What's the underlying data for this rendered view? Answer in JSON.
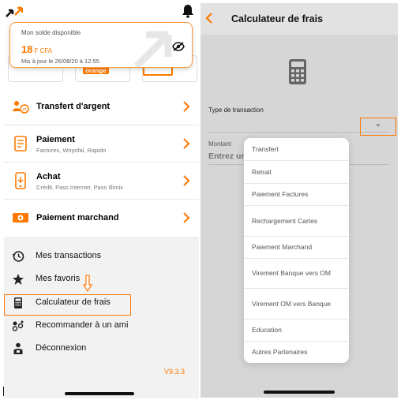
{
  "left": {
    "balance": {
      "label": "Mon solde disponible",
      "amount": "18",
      "currency": "F CFA",
      "updated": "Mis à jour le 26/08/20 à 12:55"
    },
    "orange_tag": "orange",
    "menu": [
      {
        "title": "Transfert d'argent",
        "subtitle": "",
        "icon": "transfer-icon"
      },
      {
        "title": "Paiement",
        "subtitle": "Factures, Woyofal, Rapido",
        "icon": "bill-icon"
      },
      {
        "title": "Achat",
        "subtitle": "Crédit, Pass Internet, Pass Illimix",
        "icon": "phone-icon"
      },
      {
        "title": "Paiement marchand",
        "subtitle": "",
        "icon": "cash-icon"
      }
    ],
    "side_menu": [
      {
        "label": "Mes transactions",
        "icon": "history-icon"
      },
      {
        "label": "Mes favoris",
        "icon": "star-icon"
      },
      {
        "label": "Calculateur de frais",
        "icon": "calculator-icon"
      },
      {
        "label": "Recommander à un ami",
        "icon": "share-icon"
      },
      {
        "label": "Déconnexion",
        "icon": "logout-icon"
      }
    ],
    "version": "V9.3.3"
  },
  "right": {
    "title": "Calculateur de frais",
    "type_label": "Type de transaction",
    "montant_label": "Montant",
    "montant_placeholder": "Entrez un",
    "dropdown_options": [
      "Transfert",
      "Retrait",
      "Paiement Factures",
      "Rechargement Cartes",
      "Paiement Marchand",
      "Virement Banque vers OM",
      "Virement OM vers Banque",
      "Education",
      "Autres Partenaires"
    ]
  },
  "colors": {
    "accent": "#ff7900",
    "overlay": "#d6d6d6"
  }
}
